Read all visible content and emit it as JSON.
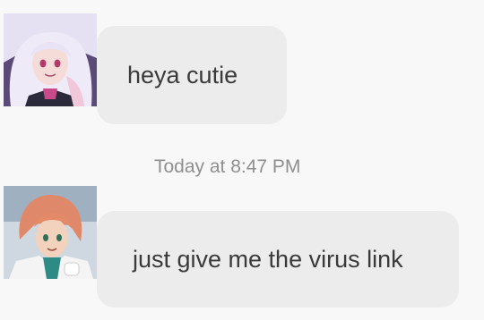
{
  "messages": [
    {
      "sender_avatar": "avatar-white-haired-girl",
      "text": "heya cutie"
    },
    {
      "sender_avatar": "avatar-orange-haired-boy",
      "text": "just give me the virus link"
    }
  ],
  "separator": {
    "timestamp": "Today at 8:47 PM"
  },
  "colors": {
    "background": "#f8f8f8",
    "bubble": "#ececec",
    "message_text": "#3a3a3a",
    "timestamp_text": "#8f8f8f"
  }
}
